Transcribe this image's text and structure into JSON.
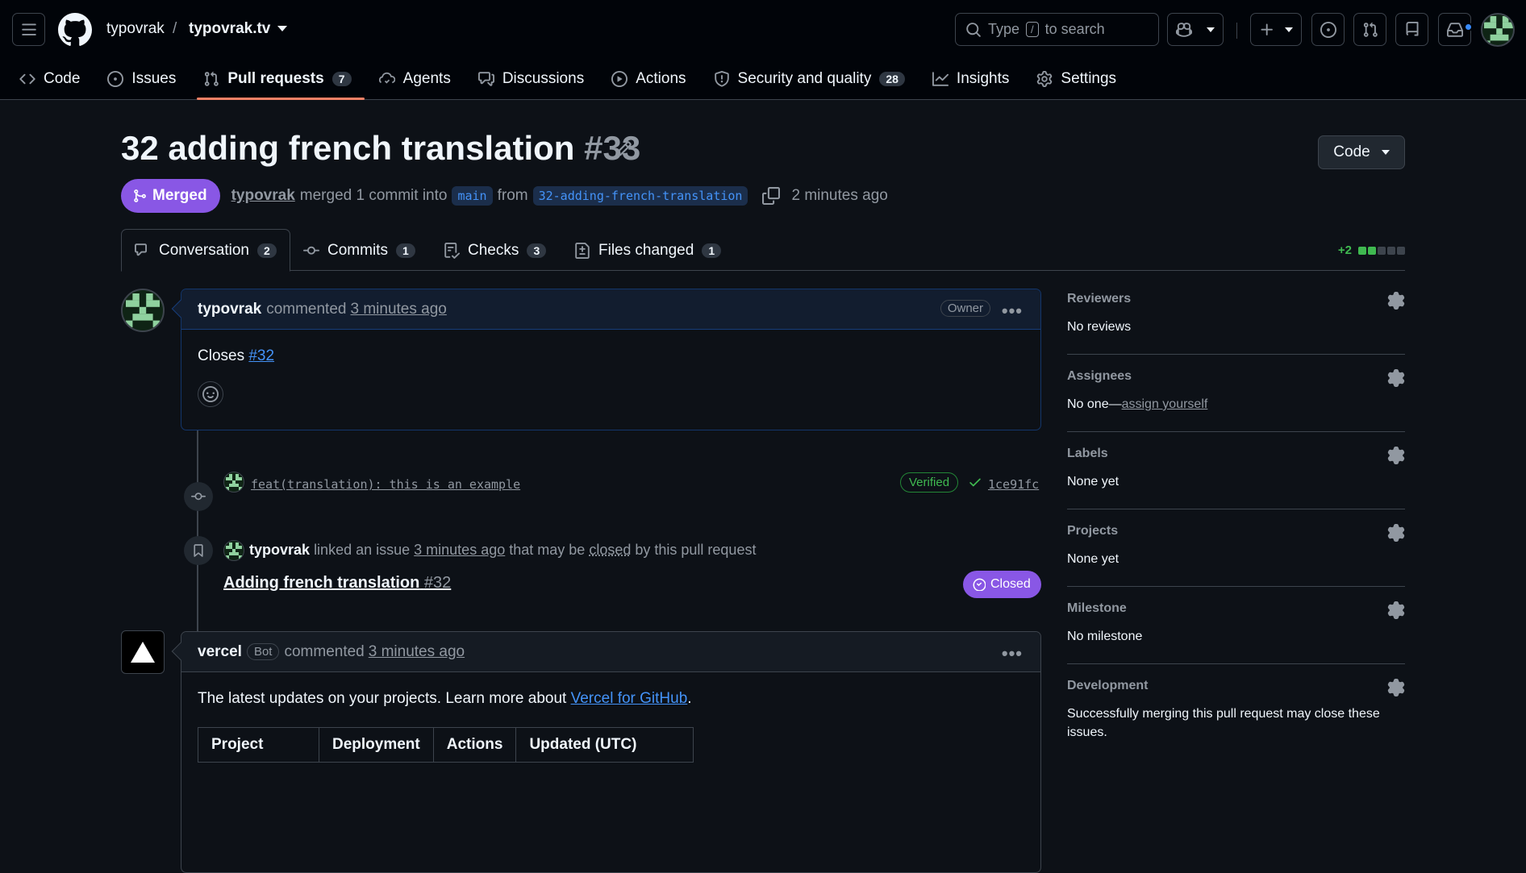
{
  "header": {
    "owner": "typovrak",
    "separator": "/",
    "repo": "typovrak.tv",
    "search_prefix": "Type",
    "search_key": "/",
    "search_suffix": "to search"
  },
  "nav": [
    {
      "label": "Code",
      "icon": "code-icon"
    },
    {
      "label": "Issues",
      "icon": "issue-opened-icon"
    },
    {
      "label": "Pull requests",
      "icon": "git-pull-request-icon",
      "count": "7",
      "active": true
    },
    {
      "label": "Agents",
      "icon": "agent-icon"
    },
    {
      "label": "Discussions",
      "icon": "comment-discussion-icon"
    },
    {
      "label": "Actions",
      "icon": "play-icon"
    },
    {
      "label": "Security and quality",
      "icon": "shield-icon",
      "count": "28"
    },
    {
      "label": "Insights",
      "icon": "graph-icon"
    },
    {
      "label": "Settings",
      "icon": "gear-icon"
    }
  ],
  "pr": {
    "title": "32 adding french translation",
    "number": "#33",
    "code_button": "Code",
    "state": "Merged",
    "author": "typovrak",
    "merged_text": "merged 1 commit into",
    "base": "main",
    "from_text": "from",
    "head": "32-adding-french-translation",
    "time": "2 minutes ago"
  },
  "tabs": [
    {
      "label": "Conversation",
      "count": "2",
      "icon": "comment-discussion-icon"
    },
    {
      "label": "Commits",
      "count": "1",
      "icon": "git-commit-icon"
    },
    {
      "label": "Checks",
      "count": "3",
      "icon": "checklist-icon"
    },
    {
      "label": "Files changed",
      "count": "1",
      "icon": "file-diff-icon"
    }
  ],
  "diffstat": {
    "text": "+2",
    "colors": [
      "#3fb950",
      "#3fb950",
      "#3d444d",
      "#3d444d",
      "#3d444d"
    ]
  },
  "comment1": {
    "author": "typovrak",
    "action": "commented",
    "time": "3 minutes ago",
    "role": "Owner",
    "body_prefix": "Closes",
    "body_link": "#32"
  },
  "commit": {
    "message": "feat(translation): this is an example",
    "verified": "Verified",
    "sha": "1ce91fc"
  },
  "linked": {
    "author": "typovrak",
    "text1": "linked an issue",
    "time": "3 minutes ago",
    "text2": "that may be",
    "closed_word": "closed",
    "text3": "by this pull request",
    "issue_title": "Adding french translation",
    "issue_number": "#32",
    "issue_state": "Closed"
  },
  "comment2": {
    "author": "vercel",
    "bot": "Bot",
    "action": "commented",
    "time": "3 minutes ago",
    "body_prefix": "The latest updates on your projects. Learn more about",
    "body_link": "Vercel for GitHub",
    "body_suffix": ".",
    "table_headers": [
      "Project",
      "Deployment",
      "Actions",
      "Updated (UTC)"
    ]
  },
  "sidebar": {
    "reviewers": {
      "title": "Reviewers",
      "value": "No reviews"
    },
    "assignees": {
      "title": "Assignees",
      "value": "No one—",
      "link": "assign yourself"
    },
    "labels": {
      "title": "Labels",
      "value": "None yet"
    },
    "projects": {
      "title": "Projects",
      "value": "None yet"
    },
    "milestone": {
      "title": "Milestone",
      "value": "No milestone"
    },
    "development": {
      "title": "Development",
      "value": "Successfully merging this pull request may close these issues."
    }
  }
}
